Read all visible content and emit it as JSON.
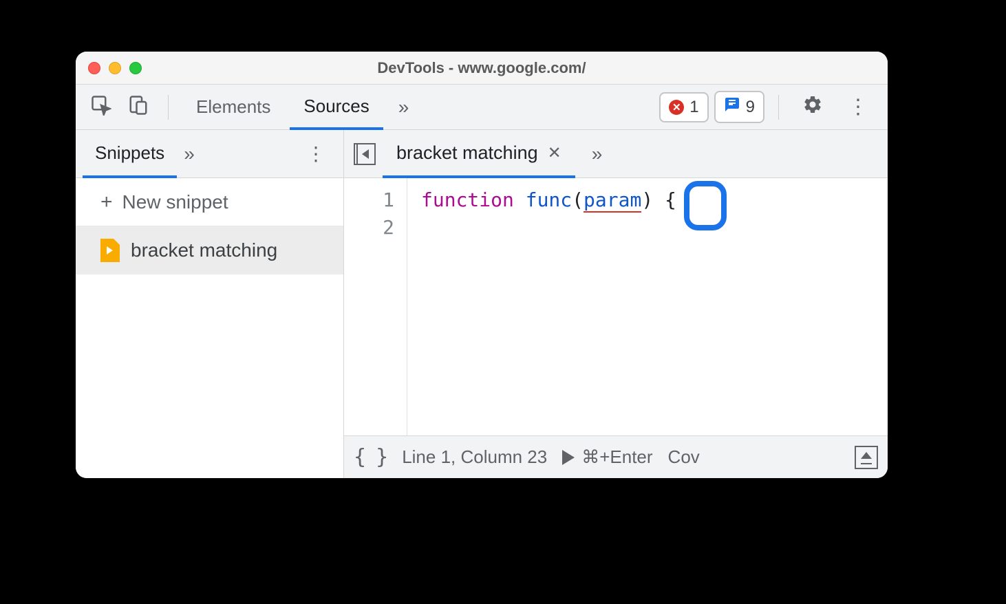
{
  "window": {
    "title": "DevTools - www.google.com/"
  },
  "toolbar": {
    "tabs": {
      "elements": "Elements",
      "sources": "Sources"
    },
    "errors_count": "1",
    "issues_count": "9"
  },
  "sidebar": {
    "tab_label": "Snippets",
    "new_snippet_label": "New snippet",
    "file_name": "bracket matching"
  },
  "editor": {
    "tab_label": "bracket matching",
    "gutter": {
      "line1": "1",
      "line2": "2"
    },
    "code": {
      "keyword": "function",
      "fn_name": "func",
      "open_paren": "(",
      "param": "param",
      "close_paren": ")",
      "space": " ",
      "brace": "{"
    }
  },
  "status": {
    "format_icon": "{ }",
    "position": "Line 1, Column 23",
    "run_hint": "⌘+Enter",
    "coverage": "Cov"
  }
}
